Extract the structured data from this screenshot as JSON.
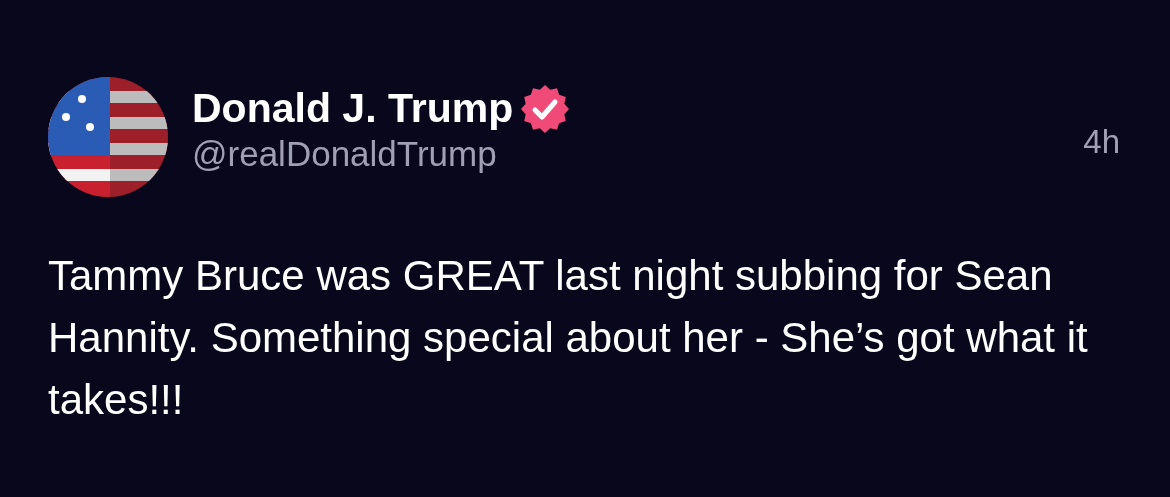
{
  "post": {
    "author": {
      "name": "Donald J. Trump",
      "verified": true,
      "handle": "@realDonaldTrump"
    },
    "time": "4h",
    "text": "Tammy Bruce was GREAT last night subbing for Sean Hannity. Something special about her - She’s got what it takes!!!"
  }
}
